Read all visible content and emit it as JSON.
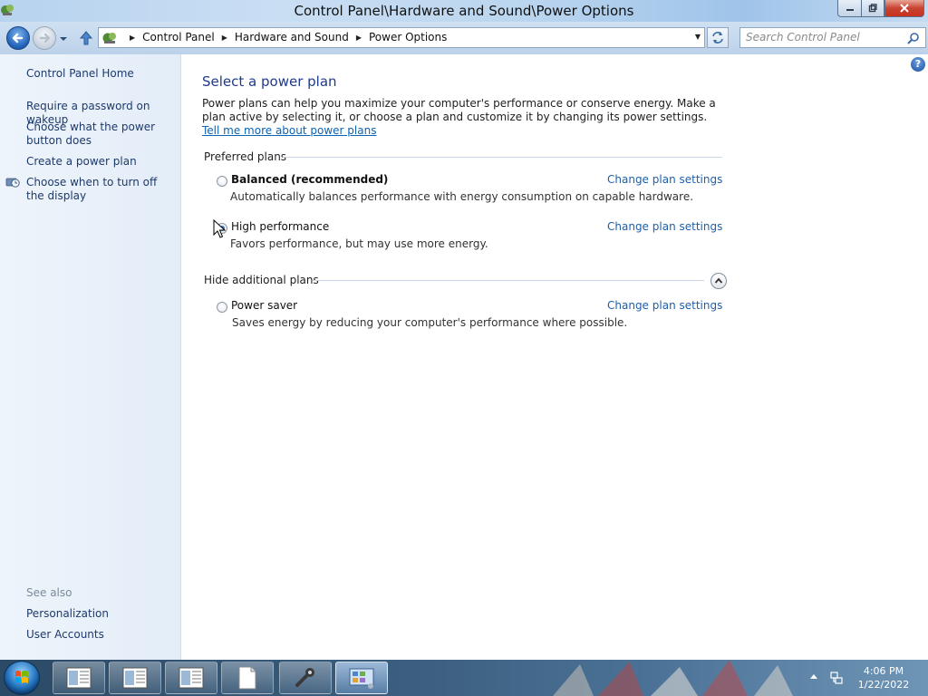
{
  "window": {
    "title": "Control Panel\\Hardware and Sound\\Power Options",
    "controls": {
      "minimize": "minimize",
      "maximize": "maximize",
      "close": "close"
    }
  },
  "navigation": {
    "breadcrumbs": [
      "Control Panel",
      "Hardware and Sound",
      "Power Options"
    ],
    "search_placeholder": "Search Control Panel"
  },
  "sidebar": {
    "home": "Control Panel Home",
    "tasks": [
      "Require a password on wakeup",
      "Choose what the power button does",
      "Create a power plan",
      "Choose when to turn off the display"
    ],
    "see_also_label": "See also",
    "see_also": [
      "Personalization",
      "User Accounts"
    ]
  },
  "main": {
    "heading": "Select a power plan",
    "intro": "Power plans can help you maximize your computer's performance or conserve energy. Make a plan active by selecting it, or choose a plan and customize it by changing its power settings.",
    "intro_link": "Tell me more about power plans",
    "preferred_label": "Preferred plans",
    "hide_label": "Hide additional plans",
    "plans": [
      {
        "name": "Balanced (recommended)",
        "description": "Automatically balances performance with energy consumption on capable hardware.",
        "link": "Change plan settings",
        "selected": false
      },
      {
        "name": "High performance",
        "description": "Favors performance, but may use more energy.",
        "link": "Change plan settings",
        "selected": true
      },
      {
        "name": "Power saver",
        "description": "Saves energy by reducing your computer's performance where possible.",
        "link": "Change plan settings",
        "selected": false
      }
    ]
  },
  "taskbar": {
    "time": "4:06 PM",
    "date": "1/22/2022"
  },
  "colors": {
    "link": "#1d5fab",
    "heading": "#1e3a8a",
    "sidebar_link": "#1e3a6b",
    "close_button": "#c8311e"
  },
  "icons": {
    "app": "control-panel-icon",
    "back": "back-arrow-icon",
    "forward": "forward-arrow-icon",
    "up": "up-arrow-icon",
    "refresh": "refresh-icon",
    "search": "search-icon",
    "help": "help-icon",
    "display_task": "display-clock-icon",
    "collapse": "chevron-up-icon",
    "start": "windows-start-icon"
  }
}
